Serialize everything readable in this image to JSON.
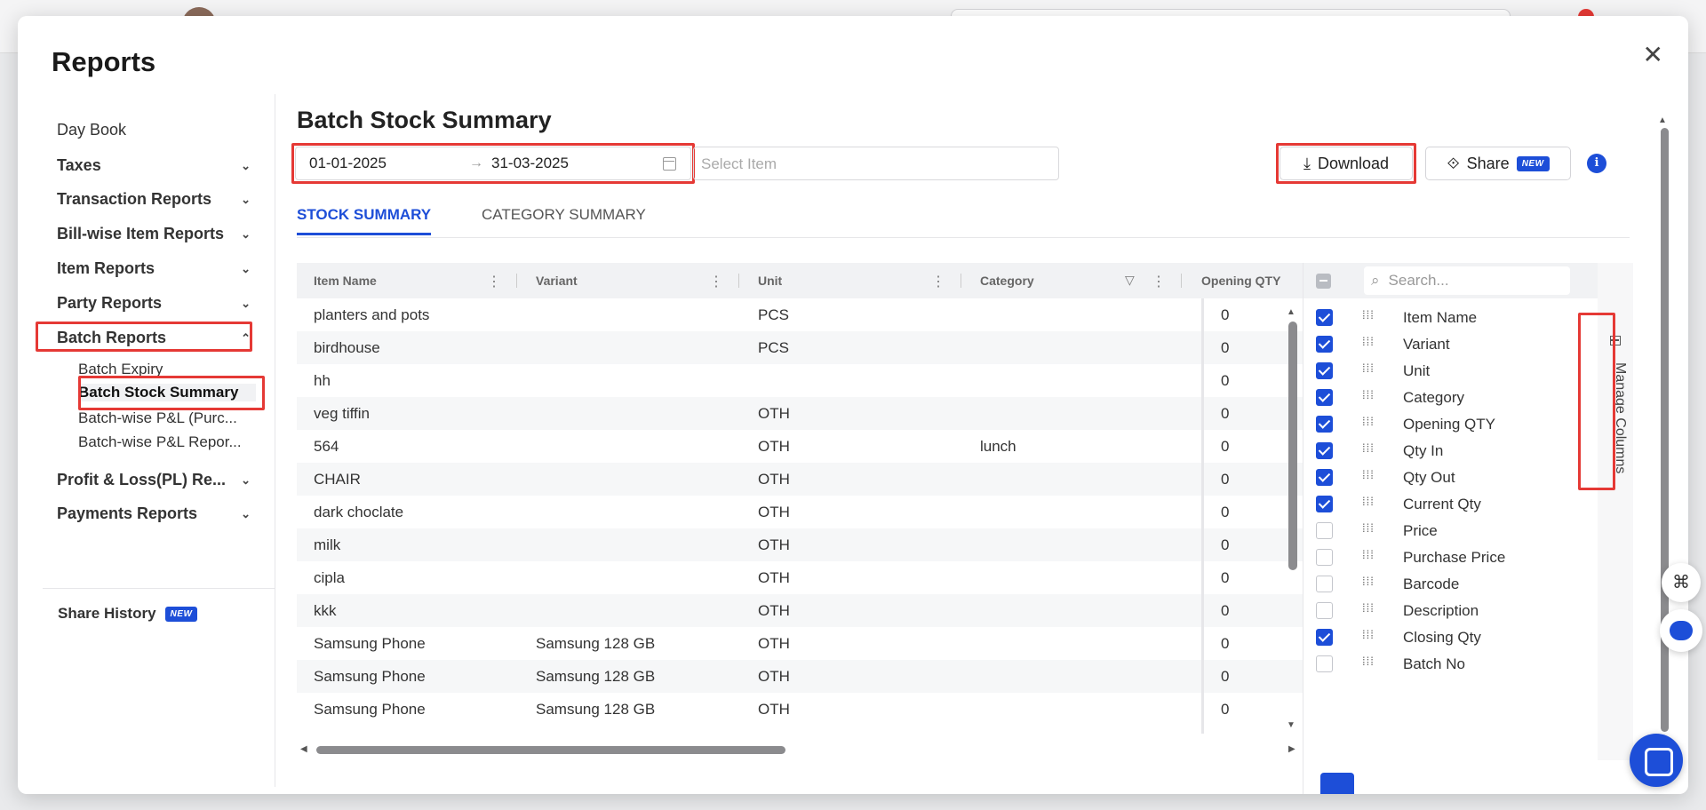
{
  "modal": {
    "title": "Reports",
    "close_symbol": "✕"
  },
  "sidebar": {
    "items": [
      {
        "label": "Day Book",
        "chevron": ""
      },
      {
        "label": "Taxes",
        "chevron": "⌄"
      },
      {
        "label": "Transaction Reports",
        "chevron": "⌄"
      },
      {
        "label": "Bill-wise Item Reports",
        "chevron": "⌄"
      },
      {
        "label": "Item Reports",
        "chevron": "⌄"
      },
      {
        "label": "Party Reports",
        "chevron": "⌄"
      },
      {
        "label": "Batch Reports",
        "chevron": "⌃"
      },
      {
        "label": "Profit & Loss(PL) Re...",
        "chevron": "⌄"
      },
      {
        "label": "Payments Reports",
        "chevron": "⌄"
      }
    ],
    "batch_sub": [
      {
        "label": "Batch Expiry"
      },
      {
        "label": "Batch Stock Summary"
      },
      {
        "label": "Batch-wise P&L (Purc..."
      },
      {
        "label": "Batch-wise P&L Repor..."
      }
    ],
    "share_history": "Share History",
    "new_badge": "NEW"
  },
  "main": {
    "title": "Batch Stock Summary",
    "date_from": "01-01-2025",
    "date_arrow": "→",
    "date_to": "31-03-2025",
    "select_item_placeholder": "Select Item",
    "download_label": "Download",
    "download_icon": "⤓",
    "share_label": "Share",
    "share_icon": "⟐",
    "share_new": "NEW",
    "info": "i",
    "tabs": [
      {
        "label": "STOCK SUMMARY"
      },
      {
        "label": "CATEGORY SUMMARY"
      }
    ]
  },
  "table": {
    "columns": [
      "Item Name",
      "Variant",
      "Unit",
      "Category",
      "Opening QTY"
    ],
    "rows": [
      {
        "item": "planters and pots",
        "variant": "",
        "unit": "PCS",
        "category": "",
        "opening": "0"
      },
      {
        "item": "birdhouse",
        "variant": "",
        "unit": "PCS",
        "category": "",
        "opening": "0"
      },
      {
        "item": "hh",
        "variant": "",
        "unit": "",
        "category": "",
        "opening": "0"
      },
      {
        "item": "veg tiffin",
        "variant": "",
        "unit": "OTH",
        "category": "",
        "opening": "0"
      },
      {
        "item": "564",
        "variant": "",
        "unit": "OTH",
        "category": "lunch",
        "opening": "0"
      },
      {
        "item": "CHAIR",
        "variant": "",
        "unit": "OTH",
        "category": "",
        "opening": "0"
      },
      {
        "item": "dark choclate",
        "variant": "",
        "unit": "OTH",
        "category": "",
        "opening": "0"
      },
      {
        "item": "milk",
        "variant": "",
        "unit": "OTH",
        "category": "",
        "opening": "0"
      },
      {
        "item": "cipla",
        "variant": "",
        "unit": "OTH",
        "category": "",
        "opening": "0"
      },
      {
        "item": "kkk",
        "variant": "",
        "unit": "OTH",
        "category": "",
        "opening": "0"
      },
      {
        "item": "Samsung Phone",
        "variant": "Samsung 128 GB",
        "unit": "OTH",
        "category": "",
        "opening": "0"
      },
      {
        "item": "Samsung Phone",
        "variant": "Samsung 128 GB",
        "unit": "OTH",
        "category": "",
        "opening": "0"
      },
      {
        "item": "Samsung Phone",
        "variant": "Samsung 128 GB",
        "unit": "OTH",
        "category": "",
        "opening": "0"
      }
    ]
  },
  "columns_panel": {
    "search_placeholder": "Search...",
    "search_icon": "⌕",
    "columns": [
      {
        "label": "Item Name",
        "checked": true
      },
      {
        "label": "Variant",
        "checked": true
      },
      {
        "label": "Unit",
        "checked": true
      },
      {
        "label": "Category",
        "checked": true
      },
      {
        "label": "Opening QTY",
        "checked": true
      },
      {
        "label": "Qty In",
        "checked": true
      },
      {
        "label": "Qty Out",
        "checked": true
      },
      {
        "label": "Current Qty",
        "checked": true
      },
      {
        "label": "Price",
        "checked": false
      },
      {
        "label": "Purchase Price",
        "checked": false
      },
      {
        "label": "Barcode",
        "checked": false
      },
      {
        "label": "Description",
        "checked": false
      },
      {
        "label": "Closing Qty",
        "checked": true
      },
      {
        "label": "Batch No",
        "checked": false
      }
    ],
    "manage_label": "Manage Columns"
  },
  "colors": {
    "accent": "#1d4ed8",
    "highlight": "#e53935"
  }
}
